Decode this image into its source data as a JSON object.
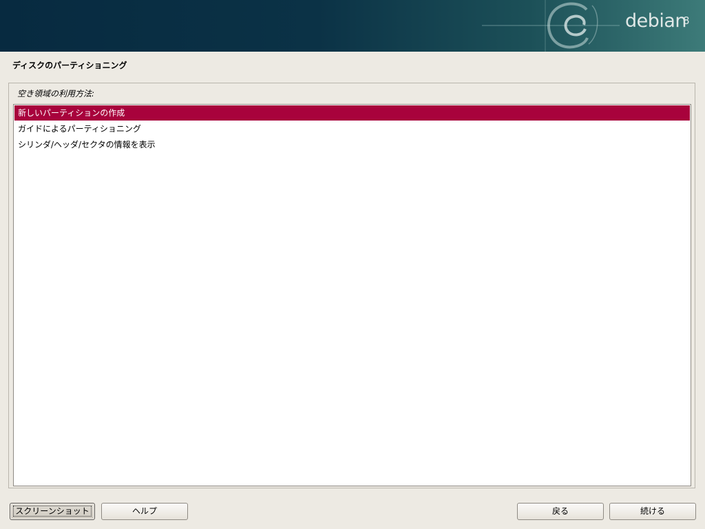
{
  "banner": {
    "brand": "debian",
    "version": "8"
  },
  "page": {
    "title": "ディスクのパーティショニング",
    "question": "空き領域の利用方法:"
  },
  "options": [
    {
      "label": "新しいパーティションの作成",
      "selected": true
    },
    {
      "label": "ガイドによるパーティショニング",
      "selected": false
    },
    {
      "label": "シリンダ/ヘッダ/セクタの情報を表示",
      "selected": false
    }
  ],
  "buttons": {
    "screenshot": "スクリーンショット",
    "help": "ヘルプ",
    "back": "戻る",
    "continue": "続ける"
  },
  "colors": {
    "selection": "#a8023c",
    "background": "#edeae3",
    "banner_dark": "#072a40",
    "banner_light": "#3d7b79"
  }
}
